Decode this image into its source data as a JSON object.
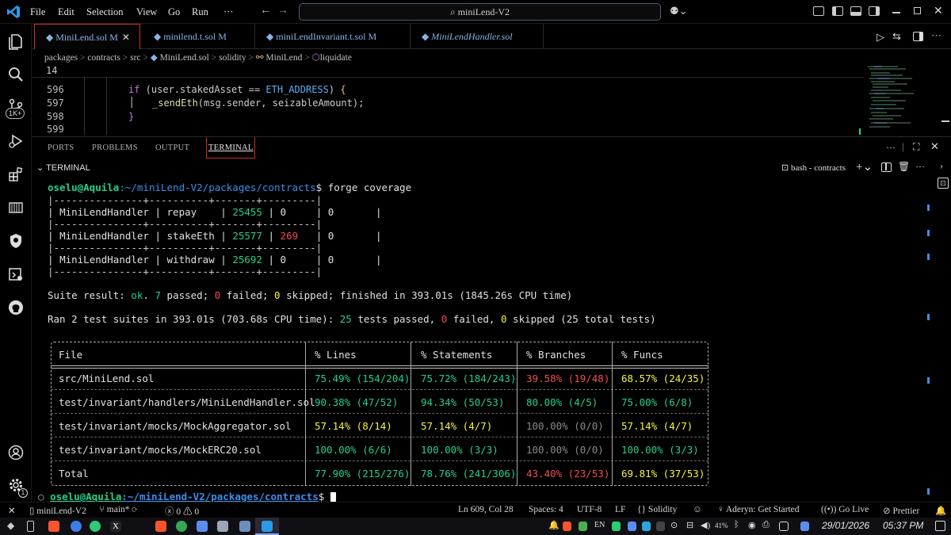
{
  "menu": {
    "app_icon": "vscode-icon",
    "items": [
      "File",
      "Edit",
      "Selection",
      "View",
      "Go",
      "Run",
      "···"
    ]
  },
  "command_center": {
    "icon": "search-icon",
    "text": "miniLend-V2"
  },
  "activity_badge": "1K+",
  "tabs": [
    {
      "label": "MiniLend.sol",
      "status": "M",
      "close": "✕",
      "active": true
    },
    {
      "label": "minilend.t.sol",
      "status": "M",
      "active": false
    },
    {
      "label": "miniLendInvariant.t.sol",
      "status": "M",
      "active": false
    },
    {
      "label": "MiniLendHandler.sol",
      "status": "",
      "active": false
    }
  ],
  "breadcrumb": [
    "packages",
    "contracts",
    "src",
    "MiniLend.sol",
    "solidity",
    "MiniLend",
    "liquidate"
  ],
  "sticky_line": "14",
  "code": [
    {
      "num": "596",
      "text": "if (user.stakedAsset == ETH_ADDRESS) {"
    },
    {
      "num": "597",
      "text": "_sendEth(msg.sender, seizableAmount);"
    },
    {
      "num": "598",
      "text": "}"
    },
    {
      "num": "599",
      "text": ""
    }
  ],
  "panel": {
    "tabs": [
      "PORTS",
      "PROBLEMS",
      "OUTPUT",
      "TERMINAL"
    ],
    "active": "TERMINAL",
    "section": "TERMINAL",
    "shell": "bash - contracts"
  },
  "terminal": {
    "prompt_user": "oselu@Aquila",
    "prompt_path": ":~/miniLend-V2/packages/contracts",
    "command": "forge coverage",
    "handler_rows": [
      {
        "contract": "MiniLendHandler",
        "fn": "repay",
        "calls": "25455",
        "reverts": "0",
        "discards": "0",
        "revert_red": false
      },
      {
        "contract": "MiniLendHandler",
        "fn": "stakeEth",
        "calls": "25577",
        "reverts": "269",
        "discards": "0",
        "revert_red": true
      },
      {
        "contract": "MiniLendHandler",
        "fn": "withdraw",
        "calls": "25692",
        "reverts": "0",
        "discards": "0",
        "revert_red": false
      }
    ],
    "suite_result": {
      "prefix": "Suite result: ",
      "status": "ok",
      "passed": "7",
      "failed": "0",
      "skipped": "0",
      "tail": "finished in 393.01s (1845.26s CPU time)"
    },
    "ran": {
      "prefix": "Ran 2 test suites in 393.01s (703.68s CPU time): ",
      "passed": "25",
      "failed": "0",
      "skipped": "0",
      "total": "(25 total tests)"
    },
    "coverage_headers": [
      "File",
      "% Lines",
      "% Statements",
      "% Branches",
      "% Funcs"
    ],
    "coverage_rows": [
      {
        "file": "src/MiniLend.sol",
        "lines": "75.49% (154/204)",
        "stmts": "75.72% (184/243)",
        "branches": "39.58% (19/48)",
        "funcs": "68.57% (24/35)",
        "c": [
          "g",
          "g",
          "r",
          "y"
        ]
      },
      {
        "file": "test/invariant/handlers/MiniLendHandler.sol",
        "lines": "90.38% (47/52)",
        "stmts": "94.34% (50/53)",
        "branches": "80.00% (4/5)",
        "funcs": "75.00% (6/8)",
        "c": [
          "g",
          "g",
          "g",
          "g"
        ]
      },
      {
        "file": "test/invariant/mocks/MockAggregator.sol",
        "lines": "57.14% (8/14)",
        "stmts": "57.14% (4/7)",
        "branches": "100.00% (0/0)",
        "funcs": "57.14% (4/7)",
        "c": [
          "y",
          "y",
          "dim",
          "y"
        ]
      },
      {
        "file": "test/invariant/mocks/MockERC20.sol",
        "lines": "100.00% (6/6)",
        "stmts": "100.00% (3/3)",
        "branches": "100.00% (0/0)",
        "funcs": "100.00% (3/3)",
        "c": [
          "g",
          "g",
          "dim",
          "g"
        ]
      },
      {
        "file": "Total",
        "lines": "77.90% (215/276)",
        "stmts": "78.76% (241/306)",
        "branches": "43.40% (23/53)",
        "funcs": "69.81% (37/53)",
        "c": [
          "g",
          "g",
          "r",
          "y"
        ]
      }
    ]
  },
  "status": {
    "workspace": "miniLend-V2",
    "branch": "main*",
    "errors": "0",
    "warnings": "0",
    "cursor": "Ln 609, Col 28",
    "spaces": "Spaces: 4",
    "encoding": "UTF-8",
    "eol": "LF",
    "language": "Solidity",
    "aderyn": "Aderyn: Get Started",
    "live": "Go Live",
    "prettier": "Prettier"
  },
  "taskbar": {
    "lang": "EN",
    "battery": "41%",
    "date": "29/01/2026",
    "time": "05:37 PM"
  },
  "colors": {
    "accent": "#d0301e",
    "prompt_green": "#23d18b",
    "prompt_blue": "#3b8eea",
    "link_blue": "#8bb2e8"
  }
}
